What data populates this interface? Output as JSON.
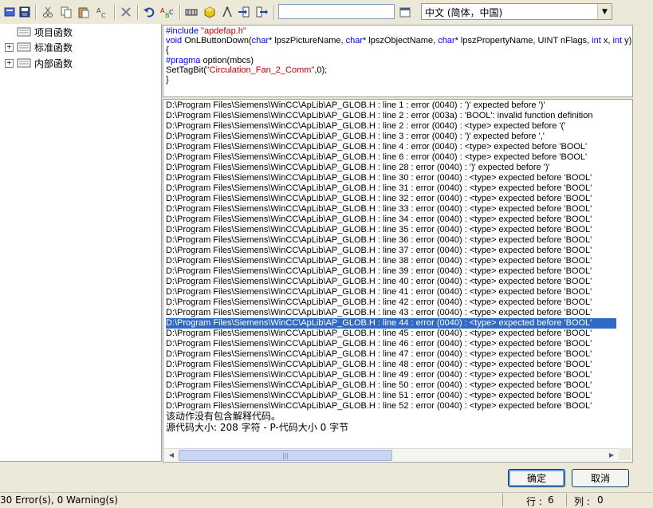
{
  "toolbar": {
    "language_value": "中文 (简体，中国)",
    "search_value": ""
  },
  "tree": {
    "items": [
      {
        "label": "项目函数"
      },
      {
        "label": "标准函数"
      },
      {
        "label": "内部函数"
      }
    ]
  },
  "editor": {
    "line1_directive": "#include",
    "line1_file": " \"apdefap.h\"",
    "line2_void": "void",
    "line2_a": " OnLButtonDown(",
    "line2_char1": "char",
    "line2_b": "* lpszPictureName, ",
    "line2_char2": "char",
    "line2_c": "* lpszObjectName, ",
    "line2_char3": "char",
    "line2_d": "* lpszPropertyName, UINT nFlags, ",
    "line2_int1": "int",
    "line2_e": " x, ",
    "line2_int2": "int",
    "line2_f": " y)",
    "line3": "{",
    "line4_pragma": "#pragma",
    "line4_rest": " option(mbcs)",
    "line5_a": "SetTagBit(",
    "line5_str": "\"Circulation_Fan_2_Comm\"",
    "line5_b": ",0);",
    "line6": "}"
  },
  "output": {
    "lines": [
      "D:\\Program Files\\Siemens\\WinCC\\ApLib\\AP_GLOB.H : line 1 : error (0040) : ')' expected before ')'",
      "D:\\Program Files\\Siemens\\WinCC\\ApLib\\AP_GLOB.H : line 2 : error (003a) : 'BOOL': invalid function definition",
      "D:\\Program Files\\Siemens\\WinCC\\ApLib\\AP_GLOB.H : line 2 : error (0040) : <type> expected before '('",
      "D:\\Program Files\\Siemens\\WinCC\\ApLib\\AP_GLOB.H : line 3 : error (0040) : ')' expected before ','",
      "D:\\Program Files\\Siemens\\WinCC\\ApLib\\AP_GLOB.H : line 4 : error (0040) : <type> expected before 'BOOL'",
      "D:\\Program Files\\Siemens\\WinCC\\ApLib\\AP_GLOB.H : line 6 : error (0040) : <type> expected before 'BOOL'",
      "D:\\Program Files\\Siemens\\WinCC\\ApLib\\AP_GLOB.H : line 28 : error (0040) : ')' expected before ')'",
      "D:\\Program Files\\Siemens\\WinCC\\ApLib\\AP_GLOB.H : line 30 : error (0040) : <type> expected before 'BOOL'",
      "D:\\Program Files\\Siemens\\WinCC\\ApLib\\AP_GLOB.H : line 31 : error (0040) : <type> expected before 'BOOL'",
      "D:\\Program Files\\Siemens\\WinCC\\ApLib\\AP_GLOB.H : line 32 : error (0040) : <type> expected before 'BOOL'",
      "D:\\Program Files\\Siemens\\WinCC\\ApLib\\AP_GLOB.H : line 33 : error (0040) : <type> expected before 'BOOL'",
      "D:\\Program Files\\Siemens\\WinCC\\ApLib\\AP_GLOB.H : line 34 : error (0040) : <type> expected before 'BOOL'",
      "D:\\Program Files\\Siemens\\WinCC\\ApLib\\AP_GLOB.H : line 35 : error (0040) : <type> expected before 'BOOL'",
      "D:\\Program Files\\Siemens\\WinCC\\ApLib\\AP_GLOB.H : line 36 : error (0040) : <type> expected before 'BOOL'",
      "D:\\Program Files\\Siemens\\WinCC\\ApLib\\AP_GLOB.H : line 37 : error (0040) : <type> expected before 'BOOL'",
      "D:\\Program Files\\Siemens\\WinCC\\ApLib\\AP_GLOB.H : line 38 : error (0040) : <type> expected before 'BOOL'",
      "D:\\Program Files\\Siemens\\WinCC\\ApLib\\AP_GLOB.H : line 39 : error (0040) : <type> expected before 'BOOL'",
      "D:\\Program Files\\Siemens\\WinCC\\ApLib\\AP_GLOB.H : line 40 : error (0040) : <type> expected before 'BOOL'",
      "D:\\Program Files\\Siemens\\WinCC\\ApLib\\AP_GLOB.H : line 41 : error (0040) : <type> expected before 'BOOL'",
      "D:\\Program Files\\Siemens\\WinCC\\ApLib\\AP_GLOB.H : line 42 : error (0040) : <type> expected before 'BOOL'",
      "D:\\Program Files\\Siemens\\WinCC\\ApLib\\AP_GLOB.H : line 43 : error (0040) : <type> expected before 'BOOL'",
      "D:\\Program Files\\Siemens\\WinCC\\ApLib\\AP_GLOB.H : line 44 : error (0040) : <type> expected before 'BOOL'",
      "D:\\Program Files\\Siemens\\WinCC\\ApLib\\AP_GLOB.H : line 45 : error (0040) : <type> expected before 'BOOL'",
      "D:\\Program Files\\Siemens\\WinCC\\ApLib\\AP_GLOB.H : line 46 : error (0040) : <type> expected before 'BOOL'",
      "D:\\Program Files\\Siemens\\WinCC\\ApLib\\AP_GLOB.H : line 47 : error (0040) : <type> expected before 'BOOL'",
      "D:\\Program Files\\Siemens\\WinCC\\ApLib\\AP_GLOB.H : line 48 : error (0040) : <type> expected before 'BOOL'",
      "D:\\Program Files\\Siemens\\WinCC\\ApLib\\AP_GLOB.H : line 49 : error (0040) : <type> expected before 'BOOL'",
      "D:\\Program Files\\Siemens\\WinCC\\ApLib\\AP_GLOB.H : line 50 : error (0040) : <type> expected before 'BOOL'",
      "D:\\Program Files\\Siemens\\WinCC\\ApLib\\AP_GLOB.H : line 51 : error (0040) : <type> expected before 'BOOL'",
      "D:\\Program Files\\Siemens\\WinCC\\ApLib\\AP_GLOB.H : line 52 : error (0040) : <type> expected before 'BOOL'"
    ],
    "selected_index": 21,
    "message1": "该动作没有包含解释代码。",
    "message2": "源代码大小: 208 字符 - P-代码大小 0 字节"
  },
  "buttons": {
    "ok": "确定",
    "cancel": "取消"
  },
  "status": {
    "errors": "30 Error(s), 0 Warning(s)",
    "row_label": "行 :",
    "row_value": "6",
    "col_label": "列 :",
    "col_value": "0"
  },
  "colors": {
    "selection": "#316ac5",
    "keyword": "#0000ff",
    "string": "#c00000"
  }
}
